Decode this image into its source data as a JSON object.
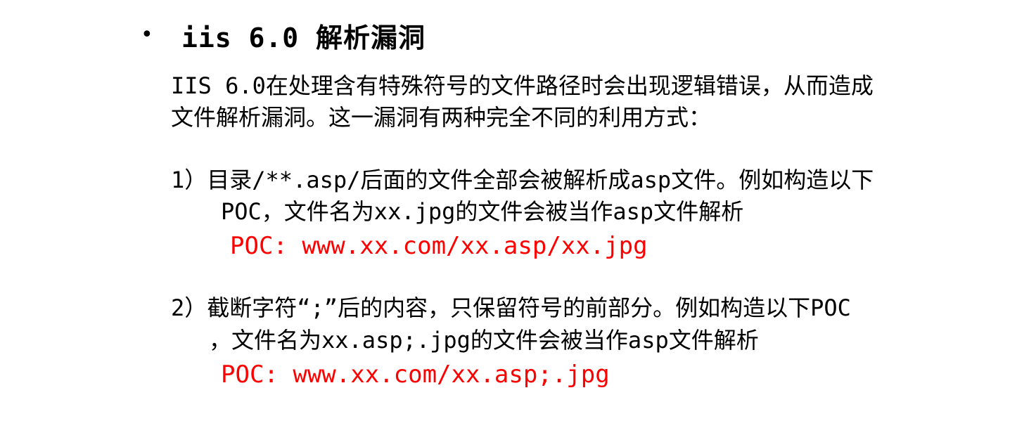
{
  "heading": {
    "bullet": "•",
    "title": "iis 6.0 解析漏洞"
  },
  "intro": {
    "line1": "IIS 6.0在处理含有特殊符号的文件路径时会出现逻辑错误，从而造成",
    "line2": "文件解析漏洞。这一漏洞有两种完全不同的利用方式："
  },
  "items": [
    {
      "line1": "1）目录/**.asp/后面的文件全部会被解析成asp文件。例如构造以下",
      "line2": "POC，文件名为xx.jpg的文件会被当作asp文件解析",
      "poc": "POC: www.xx.com/xx.asp/xx.jpg"
    },
    {
      "line1": "2）截断字符“;”后的内容，只保留符号的前部分。例如构造以下POC",
      "line2": "，文件名为xx.asp;.jpg的文件会被当作asp文件解析",
      "poc": "POC: www.xx.com/xx.asp;.jpg"
    }
  ],
  "colors": {
    "text": "#000000",
    "poc": "#ff0000",
    "background": "#ffffff"
  }
}
